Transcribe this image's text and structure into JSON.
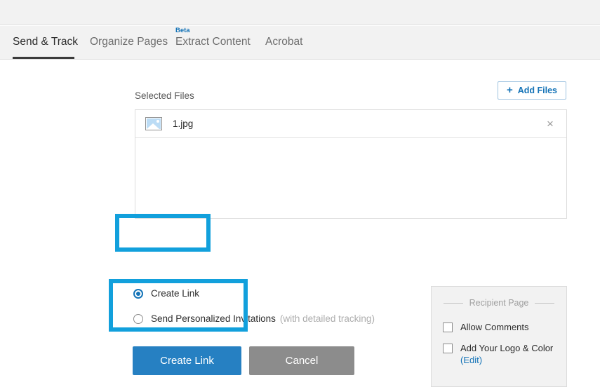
{
  "app": {
    "toolbar_area": ""
  },
  "tabs": [
    {
      "id": "send-track",
      "label": "Send & Track",
      "active": true,
      "badge": ""
    },
    {
      "id": "organize-pages",
      "label": "Organize Pages",
      "active": false,
      "badge": ""
    },
    {
      "id": "extract-content",
      "label": "Extract Content",
      "active": false,
      "badge": "Beta"
    },
    {
      "id": "acrobat",
      "label": "Acrobat",
      "active": false,
      "badge": ""
    }
  ],
  "main": {
    "selected_files_label": "Selected Files",
    "add_files_button": {
      "label": "Add Files",
      "plus": "+"
    },
    "files": [
      {
        "name": "1.jpg",
        "icon": "image-thumbnail-icon",
        "remove_glyph": "×"
      }
    ],
    "options": [
      {
        "id": "create-link",
        "label": "Create Link",
        "sublabel": "",
        "selected": true
      },
      {
        "id": "send-personalized-invitations",
        "label": "Send Personalized Invitations",
        "sublabel": "(with detailed tracking)",
        "selected": false
      }
    ],
    "actions": {
      "primary_label": "Create Link",
      "secondary_label": "Cancel"
    }
  },
  "recipient_panel": {
    "title": "Recipient Page",
    "checkboxes": [
      {
        "id": "allow-comments",
        "label": "Allow Comments",
        "checked": false
      },
      {
        "id": "add-your-logo-and-color",
        "label": "Add Your Logo & Color",
        "checked": false
      }
    ],
    "edit_link_label": "(Edit)"
  },
  "colors": {
    "accent_blue": "#2680c2",
    "link_blue": "#1473b7",
    "highlight_cyan": "#12a0dc",
    "cancel_gray": "#8c8c8c",
    "chrome_gray": "#f2f2f2"
  },
  "annotations": [
    {
      "id": "highlight-create-link-radio",
      "target": "create-link-radio-option"
    },
    {
      "id": "highlight-create-link-button",
      "target": "create-link-primary-button"
    }
  ]
}
